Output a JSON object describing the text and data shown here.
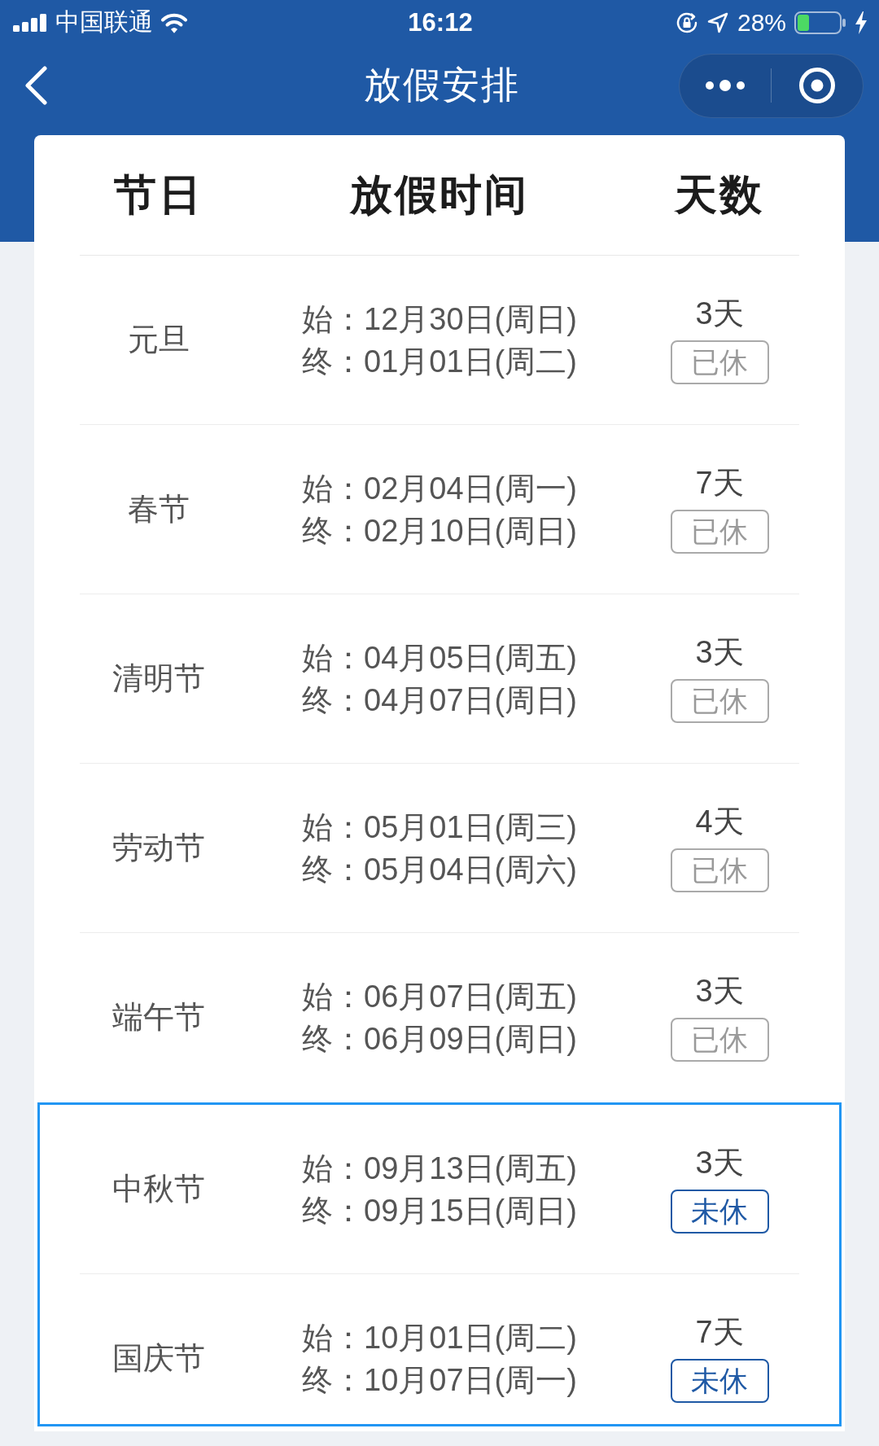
{
  "status_bar": {
    "carrier": "中国联通",
    "time": "16:12",
    "battery": "28%"
  },
  "nav": {
    "title": "放假安排"
  },
  "table": {
    "columns": [
      "节日",
      "放假时间",
      "天数"
    ],
    "rows": [
      {
        "name": "元旦",
        "start": "始：12月30日(周日)",
        "end": "终：01月01日(周二)",
        "days": "3天",
        "status": "已休",
        "taken": true,
        "highlighted": false
      },
      {
        "name": "春节",
        "start": "始：02月04日(周一)",
        "end": "终：02月10日(周日)",
        "days": "7天",
        "status": "已休",
        "taken": true,
        "highlighted": false
      },
      {
        "name": "清明节",
        "start": "始：04月05日(周五)",
        "end": "终：04月07日(周日)",
        "days": "3天",
        "status": "已休",
        "taken": true,
        "highlighted": false
      },
      {
        "name": "劳动节",
        "start": "始：05月01日(周三)",
        "end": "终：05月04日(周六)",
        "days": "4天",
        "status": "已休",
        "taken": true,
        "highlighted": false
      },
      {
        "name": "端午节",
        "start": "始：06月07日(周五)",
        "end": "终：06月09日(周日)",
        "days": "3天",
        "status": "已休",
        "taken": true,
        "highlighted": false
      },
      {
        "name": "中秋节",
        "start": "始：09月13日(周五)",
        "end": "终：09月15日(周日)",
        "days": "3天",
        "status": "未休",
        "taken": false,
        "highlighted": true
      },
      {
        "name": "国庆节",
        "start": "始：10月01日(周二)",
        "end": "终：10月07日(周一)",
        "days": "7天",
        "status": "未休",
        "taken": false,
        "highlighted": true
      }
    ]
  }
}
